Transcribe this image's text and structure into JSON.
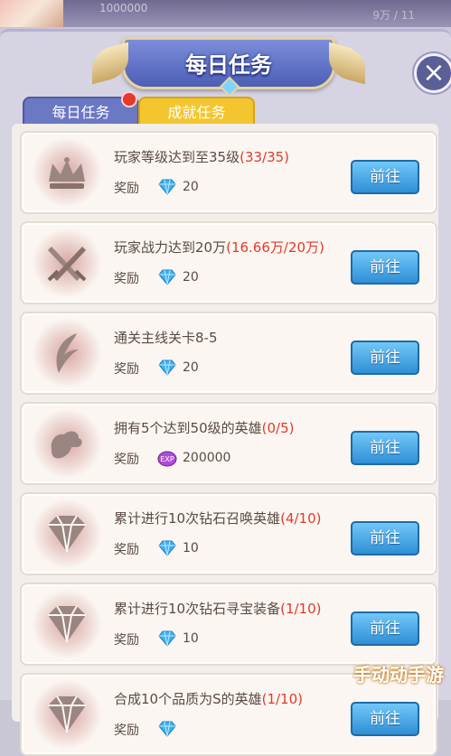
{
  "header": {
    "title": "每日任务",
    "close_label": "×"
  },
  "background": {
    "left_text": "1000000",
    "right_text": "9万 / 11"
  },
  "tabs": [
    {
      "label": "每日任务",
      "active": false,
      "has_notification": true
    },
    {
      "label": "成就任务",
      "active": true,
      "has_notification": false
    }
  ],
  "tasks": [
    {
      "title": "玩家等级达到至35级",
      "progress": "(33/35)",
      "reward_label": "奖励",
      "reward_icon": "diamond-icon",
      "reward_value": "20",
      "button": "前往",
      "icon": "crown-icon"
    },
    {
      "title": "玩家战力达到20万",
      "progress": "(16.66万/20万)",
      "reward_label": "奖励",
      "reward_icon": "diamond-icon",
      "reward_value": "20",
      "button": "前往",
      "icon": "crossed-swords-icon"
    },
    {
      "title": "通关主线关卡8-5",
      "progress": "",
      "reward_label": "奖励",
      "reward_icon": "diamond-icon",
      "reward_value": "20",
      "button": "前往",
      "icon": "feather-icon"
    },
    {
      "title": "拥有5个达到50级的英雄",
      "progress": "(0/5)",
      "reward_label": "奖励",
      "reward_icon": "exp-potion-icon",
      "reward_value": "200000",
      "button": "前往",
      "icon": "arm-icon"
    },
    {
      "title": "累计进行10次钻石召唤英雄",
      "progress": "(4/10)",
      "reward_label": "奖励",
      "reward_icon": "diamond-icon",
      "reward_value": "10",
      "button": "前往",
      "icon": "gem-icon"
    },
    {
      "title": "累计进行10次钻石寻宝装备",
      "progress": "(1/10)",
      "reward_label": "奖励",
      "reward_icon": "diamond-icon",
      "reward_value": "10",
      "button": "前往",
      "icon": "gem-icon"
    },
    {
      "title": "合成10个品质为S的英雄",
      "progress": "(1/10)",
      "reward_label": "奖励",
      "reward_icon": "diamond-icon",
      "reward_value": "",
      "button": "前往",
      "icon": "gem-icon"
    }
  ],
  "watermark": "手动动手游",
  "colors": {
    "accent_blue": "#2f8fd6",
    "progress_red": "#e23a2b",
    "tab_active": "#f3c630",
    "tab_inactive": "#6b78c4"
  }
}
